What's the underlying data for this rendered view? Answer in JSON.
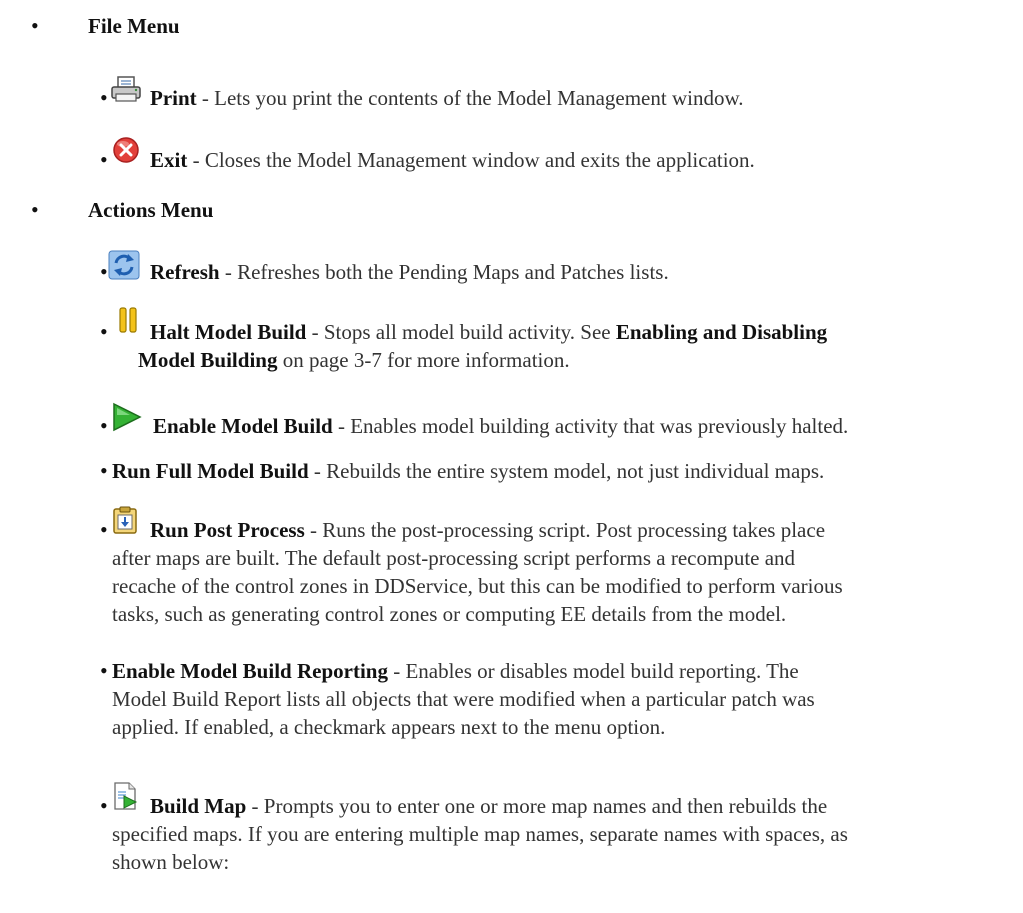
{
  "file_menu": {
    "heading": "File Menu",
    "items": [
      {
        "icon": "printer-icon",
        "name": "Print",
        "desc": " - Lets you print the contents of the Model Management window."
      },
      {
        "icon": "exit-icon",
        "name": "Exit",
        "desc": " - Closes the Model Management window and exits the application."
      }
    ]
  },
  "actions_menu": {
    "heading": "Actions Menu",
    "refresh": {
      "icon": "refresh-icon",
      "name": "Refresh",
      "desc": " - Refreshes both the Pending Maps and Patches lists."
    },
    "halt": {
      "icon": "pause-icon",
      "name": "Halt Model Build",
      "desc_1": " - Stops all model build activity. See ",
      "link_1": "Enabling and Disabling",
      "link_2": "Model Building",
      "desc_2": " on page 3-7 for more information."
    },
    "enable": {
      "icon": "play-icon",
      "name": "Enable Model Build",
      "desc": " - Enables model building activity that was previously halted."
    },
    "full": {
      "name": "Run Full Model Build",
      "desc": " - Rebuilds the entire system model, not just individual maps."
    },
    "post": {
      "icon": "post-process-icon",
      "name": "Run Post Process",
      "line_1": " - Runs the post-processing script. Post processing takes place",
      "line_2": "after maps are built. The default post-processing script performs a recompute and",
      "line_3": "recache of the control zones in DDService, but this can be modified to perform various",
      "line_4": "tasks, such as generating control zones or computing EE details from the model."
    },
    "reporting": {
      "name": "Enable Model Build Reporting",
      "line_1": " - Enables or disables model build reporting. The",
      "line_2": "Model Build Report lists all objects that were modified when a particular patch was",
      "line_3": "applied. If enabled, a checkmark appears next to the menu option."
    },
    "build_map": {
      "icon": "build-map-icon",
      "name": "Build Map",
      "line_1": " - Prompts you to enter one or more map names and then rebuilds the",
      "line_2": "specified maps. If you are entering multiple map names, separate names with spaces, as",
      "line_3": "shown below:"
    }
  },
  "bullet_char": "•"
}
